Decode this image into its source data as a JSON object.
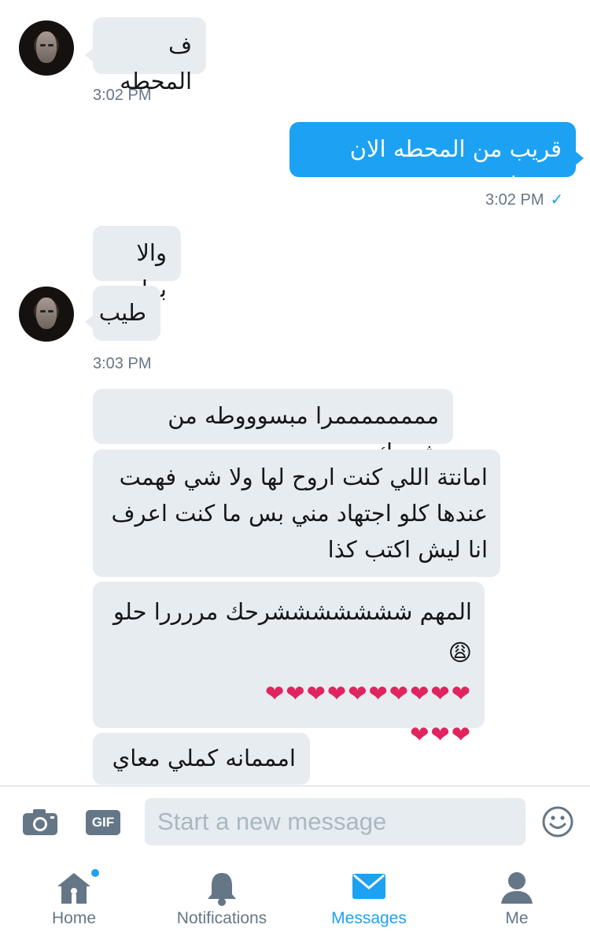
{
  "conversation": {
    "messages": [
      {
        "text": "ف المحطه"
      },
      {
        "text": "قريب من المحطه الان بيوصل"
      },
      {
        "text": "والا برا"
      },
      {
        "text": "طيب"
      },
      {
        "text": "ممممممممرا مبسوووطه من شرحك"
      },
      {
        "lines": [
          "امانتة اللي كنت اروح لها ولا شي فهمت",
          "عندها كلو اجتهاد مني بس ما كنت اعرف",
          "انا ليش اكتب كذا"
        ]
      },
      {
        "text": "المهم شششششششرحك مررررا حلو 😩",
        "hearts_row1": "❤❤❤❤❤❤❤❤❤❤",
        "hearts_row2": "❤❤❤"
      },
      {
        "text": "امممانه كملي معاي"
      }
    ],
    "timestamps": [
      "3:02 PM",
      "3:02 PM",
      "3:03 PM"
    ],
    "read_mark": "✓"
  },
  "composer": {
    "placeholder": "Start a new message",
    "camera_icon": "camera-icon",
    "gif_label": "GIF",
    "emoji_icon": "emoji-icon"
  },
  "tabbar": {
    "tabs": [
      {
        "label": "Home",
        "icon": "home-icon",
        "badge_dot": true
      },
      {
        "label": "Notifications",
        "icon": "bell-icon"
      },
      {
        "label": "Messages",
        "icon": "envelope-icon",
        "active": true
      },
      {
        "label": "Me",
        "icon": "person-icon"
      }
    ]
  },
  "colors": {
    "accent": "#1da1f2",
    "bubble_incoming": "#e6ecf0",
    "secondary_text": "#657786"
  }
}
